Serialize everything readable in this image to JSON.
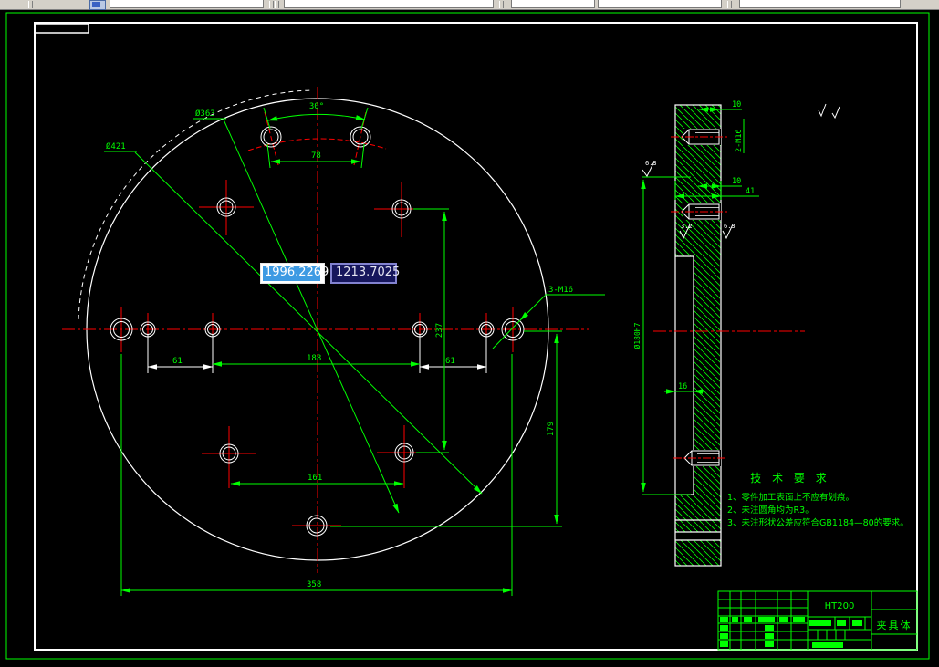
{
  "toolbar": {
    "icons": [
      "layer-properties-icon"
    ]
  },
  "dynamic_input": {
    "x_value": "1996.2269",
    "y_value": "1213.7025"
  },
  "front_view": {
    "labels": {
      "outer_dia": "Ø421",
      "bolt_circle_dia": "Ø363",
      "angle": "30°",
      "top_span": "78",
      "left_pair": "61",
      "right_pair": "61",
      "mid_span": "188",
      "right_vertical": "237",
      "lower_span": "161",
      "outer_vertical": "179",
      "bottom_span": "358",
      "thread_note": "3-M16"
    }
  },
  "side_view": {
    "labels": {
      "edge_offset": "10",
      "thread_note": "2-M16",
      "step_offset": "10",
      "thickness": "41",
      "bore_dia": "Ø180H7",
      "recess_depth": "16"
    },
    "roughness": {
      "r1": "6.3",
      "r2": "3.2",
      "r3": "6.3"
    }
  },
  "tech_requirements": {
    "title": "技 术 要 求",
    "item1": "1、零件加工表面上不应有划痕。",
    "item2": "2、未注圆角均为R3。",
    "item3": "3、未注形状公差应符合GB1184—80的要求。"
  },
  "title_block": {
    "material": "HT200",
    "part_name": "夹具体"
  },
  "colors": {
    "green": "#00ff00",
    "red": "#ff0000",
    "white": "#ffffff",
    "selection_blue": "#3d9ae3",
    "tooltip_bg": "#16165c",
    "tooltip_border": "#8282cf",
    "toolbar_bg": "#d4d0c8"
  }
}
